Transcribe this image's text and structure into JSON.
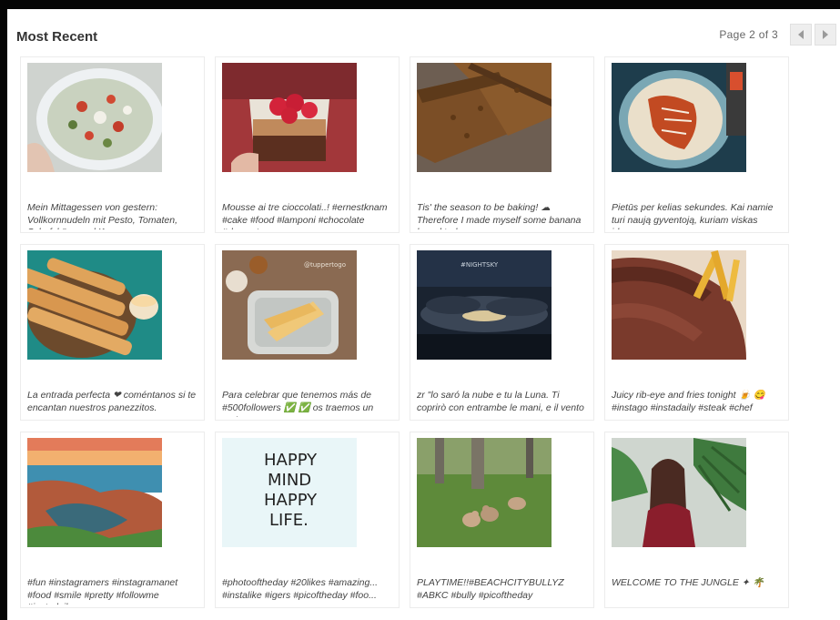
{
  "header": {
    "title": "Most Recent"
  },
  "pagination": {
    "label": "Page 2 of 3",
    "prev_icon": "triangle-left",
    "next_icon": "triangle-right"
  },
  "posts": [
    {
      "caption": "Mein Mittagessen von gestern: Vollkornnudeln mit Pesto, Tomaten, Schafskäse und Kernen",
      "image": "pasta-salad-plate"
    },
    {
      "caption": "Mousse ai tre cioccolati..! #ernestknam #cake #food #lamponi #chocolate #dessert",
      "image": "raspberry-mousse-jar"
    },
    {
      "caption": "Tis' the season to be baking! ☁Therefore I made myself some banana bread today",
      "image": "sliced-banana-bread"
    },
    {
      "caption": "Pietūs per kelias sekundes. Kai namie turi naują gyventoją, kuriam viskas įdomu",
      "image": "tortilla-plate"
    },
    {
      "caption": "La entrada perfecta ❤ coméntanos si te encantan nuestros panezzitos.",
      "image": "bread-sticks-dip"
    },
    {
      "caption": "Para celebrar que tenemos más de #500followers ✅ ✅ os traemos un sorteo",
      "image": "crepes-plate"
    },
    {
      "caption": "zr \"lo saró la nube e tu la Luna. Ti coprirò con entrambe le mani, e il vento",
      "image": "night-sky-clouds"
    },
    {
      "caption": "Juicy rib-eye and fries tonight 🍺 😋 #instago #instadaily #steak #chef",
      "image": "steak-fries"
    },
    {
      "caption": "#fun #instagramers #instagramanet #food #smile #pretty #followme #instadaily",
      "image": "rocky-shore-sunset"
    },
    {
      "caption": "#photooftheday #20likes #amazing... #instalike #igers #picoftheday #foo...",
      "image": "happy-mind-happy-life"
    },
    {
      "caption": "PLAYTIME!!#BEACHCITYBULLYZ #ABKC #bully #picoftheday",
      "image": "dogs-in-park"
    },
    {
      "caption": "WELCOME TO THE JUNGLE ✦ 🌴",
      "image": "woman-palm-leaves"
    }
  ]
}
